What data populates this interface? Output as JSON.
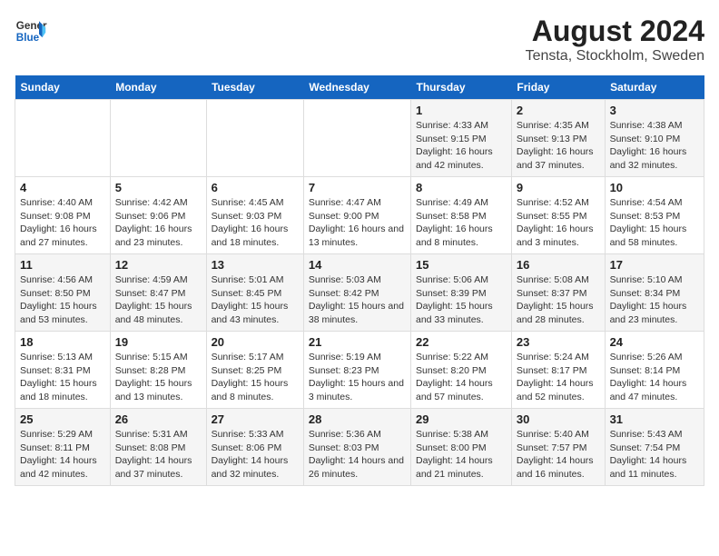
{
  "header": {
    "logo_line1": "General",
    "logo_line2": "Blue",
    "title": "August 2024",
    "subtitle": "Tensta, Stockholm, Sweden"
  },
  "days_of_week": [
    "Sunday",
    "Monday",
    "Tuesday",
    "Wednesday",
    "Thursday",
    "Friday",
    "Saturday"
  ],
  "weeks": [
    [
      {
        "num": "",
        "info": ""
      },
      {
        "num": "",
        "info": ""
      },
      {
        "num": "",
        "info": ""
      },
      {
        "num": "",
        "info": ""
      },
      {
        "num": "1",
        "info": "Sunrise: 4:33 AM\nSunset: 9:15 PM\nDaylight: 16 hours and 42 minutes."
      },
      {
        "num": "2",
        "info": "Sunrise: 4:35 AM\nSunset: 9:13 PM\nDaylight: 16 hours and 37 minutes."
      },
      {
        "num": "3",
        "info": "Sunrise: 4:38 AM\nSunset: 9:10 PM\nDaylight: 16 hours and 32 minutes."
      }
    ],
    [
      {
        "num": "4",
        "info": "Sunrise: 4:40 AM\nSunset: 9:08 PM\nDaylight: 16 hours and 27 minutes."
      },
      {
        "num": "5",
        "info": "Sunrise: 4:42 AM\nSunset: 9:06 PM\nDaylight: 16 hours and 23 minutes."
      },
      {
        "num": "6",
        "info": "Sunrise: 4:45 AM\nSunset: 9:03 PM\nDaylight: 16 hours and 18 minutes."
      },
      {
        "num": "7",
        "info": "Sunrise: 4:47 AM\nSunset: 9:00 PM\nDaylight: 16 hours and 13 minutes."
      },
      {
        "num": "8",
        "info": "Sunrise: 4:49 AM\nSunset: 8:58 PM\nDaylight: 16 hours and 8 minutes."
      },
      {
        "num": "9",
        "info": "Sunrise: 4:52 AM\nSunset: 8:55 PM\nDaylight: 16 hours and 3 minutes."
      },
      {
        "num": "10",
        "info": "Sunrise: 4:54 AM\nSunset: 8:53 PM\nDaylight: 15 hours and 58 minutes."
      }
    ],
    [
      {
        "num": "11",
        "info": "Sunrise: 4:56 AM\nSunset: 8:50 PM\nDaylight: 15 hours and 53 minutes."
      },
      {
        "num": "12",
        "info": "Sunrise: 4:59 AM\nSunset: 8:47 PM\nDaylight: 15 hours and 48 minutes."
      },
      {
        "num": "13",
        "info": "Sunrise: 5:01 AM\nSunset: 8:45 PM\nDaylight: 15 hours and 43 minutes."
      },
      {
        "num": "14",
        "info": "Sunrise: 5:03 AM\nSunset: 8:42 PM\nDaylight: 15 hours and 38 minutes."
      },
      {
        "num": "15",
        "info": "Sunrise: 5:06 AM\nSunset: 8:39 PM\nDaylight: 15 hours and 33 minutes."
      },
      {
        "num": "16",
        "info": "Sunrise: 5:08 AM\nSunset: 8:37 PM\nDaylight: 15 hours and 28 minutes."
      },
      {
        "num": "17",
        "info": "Sunrise: 5:10 AM\nSunset: 8:34 PM\nDaylight: 15 hours and 23 minutes."
      }
    ],
    [
      {
        "num": "18",
        "info": "Sunrise: 5:13 AM\nSunset: 8:31 PM\nDaylight: 15 hours and 18 minutes."
      },
      {
        "num": "19",
        "info": "Sunrise: 5:15 AM\nSunset: 8:28 PM\nDaylight: 15 hours and 13 minutes."
      },
      {
        "num": "20",
        "info": "Sunrise: 5:17 AM\nSunset: 8:25 PM\nDaylight: 15 hours and 8 minutes."
      },
      {
        "num": "21",
        "info": "Sunrise: 5:19 AM\nSunset: 8:23 PM\nDaylight: 15 hours and 3 minutes."
      },
      {
        "num": "22",
        "info": "Sunrise: 5:22 AM\nSunset: 8:20 PM\nDaylight: 14 hours and 57 minutes."
      },
      {
        "num": "23",
        "info": "Sunrise: 5:24 AM\nSunset: 8:17 PM\nDaylight: 14 hours and 52 minutes."
      },
      {
        "num": "24",
        "info": "Sunrise: 5:26 AM\nSunset: 8:14 PM\nDaylight: 14 hours and 47 minutes."
      }
    ],
    [
      {
        "num": "25",
        "info": "Sunrise: 5:29 AM\nSunset: 8:11 PM\nDaylight: 14 hours and 42 minutes."
      },
      {
        "num": "26",
        "info": "Sunrise: 5:31 AM\nSunset: 8:08 PM\nDaylight: 14 hours and 37 minutes."
      },
      {
        "num": "27",
        "info": "Sunrise: 5:33 AM\nSunset: 8:06 PM\nDaylight: 14 hours and 32 minutes."
      },
      {
        "num": "28",
        "info": "Sunrise: 5:36 AM\nSunset: 8:03 PM\nDaylight: 14 hours and 26 minutes."
      },
      {
        "num": "29",
        "info": "Sunrise: 5:38 AM\nSunset: 8:00 PM\nDaylight: 14 hours and 21 minutes."
      },
      {
        "num": "30",
        "info": "Sunrise: 5:40 AM\nSunset: 7:57 PM\nDaylight: 14 hours and 16 minutes."
      },
      {
        "num": "31",
        "info": "Sunrise: 5:43 AM\nSunset: 7:54 PM\nDaylight: 14 hours and 11 minutes."
      }
    ]
  ]
}
